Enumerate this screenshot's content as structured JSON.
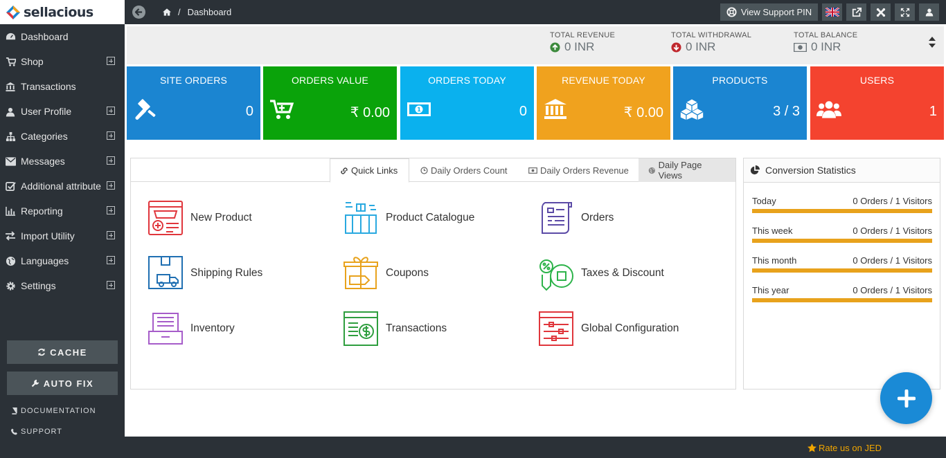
{
  "brand": {
    "name": "sellacious"
  },
  "sidebar": {
    "items": [
      {
        "label": "Dashboard",
        "icon": "dashboard-icon",
        "expandable": false
      },
      {
        "label": "Shop",
        "icon": "cart-icon",
        "expandable": true
      },
      {
        "label": "Transactions",
        "icon": "bank-icon",
        "expandable": false
      },
      {
        "label": "User Profile",
        "icon": "user-icon",
        "expandable": true
      },
      {
        "label": "Categories",
        "icon": "sitemap-icon",
        "expandable": true
      },
      {
        "label": "Messages",
        "icon": "envelope-icon",
        "expandable": true
      },
      {
        "label": "Additional attribute",
        "icon": "check-square-icon",
        "expandable": true
      },
      {
        "label": "Reporting",
        "icon": "bar-chart-icon",
        "expandable": true
      },
      {
        "label": "Import Utility",
        "icon": "exchange-icon",
        "expandable": true
      },
      {
        "label": "Languages",
        "icon": "globe-icon",
        "expandable": true
      },
      {
        "label": "Settings",
        "icon": "gear-icon",
        "expandable": true
      }
    ],
    "cache_label": "CACHE",
    "autofix_label": "AUTO FIX",
    "documentation_label": "DOCUMENTATION",
    "support_label": "SUPPORT"
  },
  "topbar": {
    "breadcrumb_sep": "/",
    "breadcrumb_current": "Dashboard",
    "support_pin_label": "View Support PIN"
  },
  "stats": {
    "revenue_label": "TOTAL REVENUE",
    "revenue_value": "0 INR",
    "withdrawal_label": "TOTAL WITHDRAWAL",
    "withdrawal_value": "0 INR",
    "balance_label": "TOTAL BALANCE",
    "balance_value": "0 INR"
  },
  "tiles": [
    {
      "title": "SITE ORDERS",
      "value": "0",
      "color": "#1b85d1",
      "icon": "gavel-icon"
    },
    {
      "title": "ORDERS VALUE",
      "value": "₹ 0.00",
      "color": "#0aa30a",
      "icon": "cart-icon"
    },
    {
      "title": "ORDERS TODAY",
      "value": "0",
      "color": "#0ab1ee",
      "icon": "money-icon"
    },
    {
      "title": "REVENUE TODAY",
      "value": "₹ 0.00",
      "color": "#f0a21e",
      "icon": "bank-icon"
    },
    {
      "title": "PRODUCTS",
      "value": "3 / 3",
      "color": "#1b85d1",
      "icon": "cubes-icon"
    },
    {
      "title": "USERS",
      "value": "1",
      "color": "#f4432f",
      "icon": "users-icon"
    }
  ],
  "tabs": [
    {
      "label": "Quick Links",
      "icon": "link-icon"
    },
    {
      "label": "Daily Orders Count",
      "icon": "clock-icon"
    },
    {
      "label": "Daily Orders Revenue",
      "icon": "money-icon"
    },
    {
      "label": "Daily Page Views",
      "icon": "globe-icon"
    }
  ],
  "quick_links": [
    {
      "label": "New Product",
      "icon": "new-product-icon",
      "color": "#e0363c"
    },
    {
      "label": "Product Catalogue",
      "icon": "product-catalogue-icon",
      "color": "#29a9e0"
    },
    {
      "label": "Orders",
      "icon": "orders-icon",
      "color": "#5b4aa6"
    },
    {
      "label": "Shipping Rules",
      "icon": "shipping-rules-icon",
      "color": "#1f6fb2"
    },
    {
      "label": "Coupons",
      "icon": "coupons-icon",
      "color": "#e8a21c"
    },
    {
      "label": "Taxes & Discount",
      "icon": "taxes-discount-icon",
      "color": "#2db34a"
    },
    {
      "label": "Inventory",
      "icon": "inventory-icon",
      "color": "#a65cc9"
    },
    {
      "label": "Transactions",
      "icon": "transactions-icon",
      "color": "#2e9e3e"
    },
    {
      "label": "Global Configuration",
      "icon": "global-configuration-icon",
      "color": "#e0363c"
    }
  ],
  "conversion": {
    "title": "Conversion Statistics",
    "rows": [
      {
        "label": "Today",
        "value": "0 Orders / 1 Visitors",
        "fill": 1.0
      },
      {
        "label": "This week",
        "value": "0 Orders / 1 Visitors",
        "fill": 1.0
      },
      {
        "label": "This month",
        "value": "0 Orders / 1 Visitors",
        "fill": 1.0
      },
      {
        "label": "This year",
        "value": "0 Orders / 1 Visitors",
        "fill": 1.0
      }
    ],
    "bar_color": "#e8a21c"
  },
  "footer": {
    "rate_label": "Rate us on JED"
  },
  "colors": {
    "sidebar_bg": "#2b3137",
    "fab": "#1a8ad6",
    "revenue_up": "#3c8a3c",
    "withdrawal_down": "#c0282d"
  }
}
